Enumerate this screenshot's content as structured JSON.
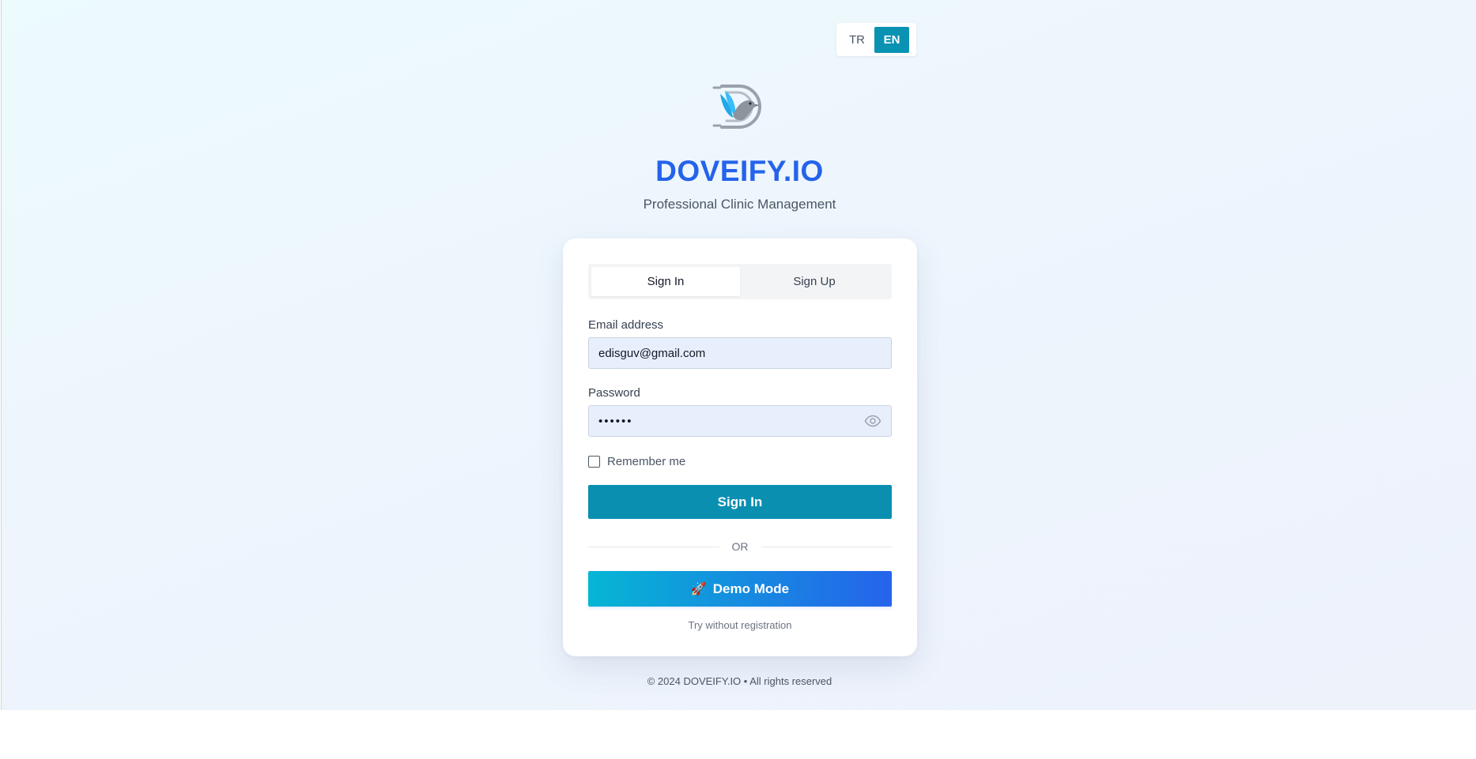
{
  "language": {
    "options": [
      "TR",
      "EN"
    ],
    "selected": "EN"
  },
  "brand": {
    "name": "DOVEIFY.IO",
    "tagline": "Professional Clinic Management",
    "colors": {
      "title": "#2563eb",
      "accent": "#0a8fb1"
    }
  },
  "auth": {
    "tabs": [
      {
        "label": "Sign In",
        "active": true
      },
      {
        "label": "Sign Up",
        "active": false
      }
    ],
    "email": {
      "label": "Email address",
      "value": "edisguv@gmail.com"
    },
    "password": {
      "label": "Password",
      "value": "••••••",
      "toggle_icon": "eye-icon"
    },
    "remember": {
      "label": "Remember me",
      "checked": false
    },
    "submit_label": "Sign In",
    "divider_text": "OR",
    "demo": {
      "icon": "🚀",
      "label": "Demo Mode",
      "note": "Try without registration"
    }
  },
  "footer": {
    "text": "© 2024 DOVEIFY.IO • All rights reserved"
  }
}
